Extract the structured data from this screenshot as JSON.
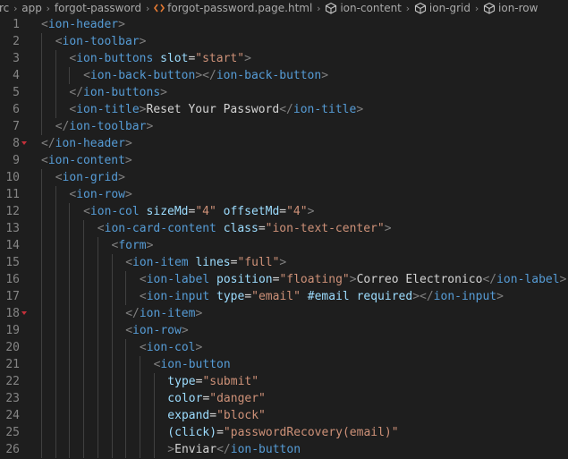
{
  "breadcrumb": {
    "segments": [
      {
        "label": "rc",
        "icon": ""
      },
      {
        "label": "app",
        "icon": ""
      },
      {
        "label": "forgot-password",
        "icon": ""
      },
      {
        "label": "forgot-password.page.html",
        "icon": "html-file-icon"
      },
      {
        "label": "ion-content",
        "icon": "element-cube-icon"
      },
      {
        "label": "ion-grid",
        "icon": "element-cube-icon"
      },
      {
        "label": "ion-row",
        "icon": "element-cube-icon"
      }
    ],
    "separator": "›"
  },
  "colors": {
    "background": "#1e1e1e",
    "line_number": "#858585",
    "punctuation": "#808080",
    "tag": "#569cd6",
    "attribute": "#9cdcfe",
    "string": "#ce9178",
    "text": "#d4d4d4",
    "fold_marker": "#c5303a"
  },
  "lines": [
    {
      "n": "1",
      "indent": 0,
      "tokens": [
        [
          "pn",
          "<"
        ],
        [
          "tg",
          "ion-header"
        ],
        [
          "pn",
          ">"
        ]
      ]
    },
    {
      "n": "2",
      "indent": 1,
      "tokens": [
        [
          "pn",
          "<"
        ],
        [
          "tg",
          "ion-toolbar"
        ],
        [
          "pn",
          ">"
        ]
      ]
    },
    {
      "n": "3",
      "indent": 2,
      "tokens": [
        [
          "pn",
          "<"
        ],
        [
          "tg",
          "ion-buttons"
        ],
        [
          "tx",
          " "
        ],
        [
          "at",
          "slot"
        ],
        [
          "tx",
          "="
        ],
        [
          "st",
          "\"start\""
        ],
        [
          "pn",
          ">"
        ]
      ]
    },
    {
      "n": "4",
      "indent": 3,
      "tokens": [
        [
          "pn",
          "<"
        ],
        [
          "tg",
          "ion-back-button"
        ],
        [
          "pn",
          "></"
        ],
        [
          "tg",
          "ion-back-button"
        ],
        [
          "pn",
          ">"
        ]
      ]
    },
    {
      "n": "5",
      "indent": 2,
      "tokens": [
        [
          "pn",
          "</"
        ],
        [
          "tg",
          "ion-buttons"
        ],
        [
          "pn",
          ">"
        ]
      ]
    },
    {
      "n": "6",
      "indent": 2,
      "tokens": [
        [
          "pn",
          "<"
        ],
        [
          "tg",
          "ion-title"
        ],
        [
          "pn",
          ">"
        ],
        [
          "tx",
          "Reset Your Password"
        ],
        [
          "pn",
          "</"
        ],
        [
          "tg",
          "ion-title"
        ],
        [
          "pn",
          ">"
        ]
      ]
    },
    {
      "n": "7",
      "indent": 1,
      "tokens": [
        [
          "pn",
          "</"
        ],
        [
          "tg",
          "ion-toolbar"
        ],
        [
          "pn",
          ">"
        ]
      ]
    },
    {
      "n": "8",
      "indent": 0,
      "fold": true,
      "tokens": [
        [
          "pn",
          "</"
        ],
        [
          "tg",
          "ion-header"
        ],
        [
          "pn",
          ">"
        ]
      ]
    },
    {
      "n": "9",
      "indent": 0,
      "tokens": [
        [
          "pn",
          "<"
        ],
        [
          "tg",
          "ion-content"
        ],
        [
          "pn",
          ">"
        ]
      ]
    },
    {
      "n": "10",
      "indent": 1,
      "tokens": [
        [
          "pn",
          "<"
        ],
        [
          "tg",
          "ion-grid"
        ],
        [
          "pn",
          ">"
        ]
      ]
    },
    {
      "n": "11",
      "indent": 2,
      "tokens": [
        [
          "pn",
          "<"
        ],
        [
          "tg",
          "ion-row"
        ],
        [
          "pn",
          ">"
        ]
      ]
    },
    {
      "n": "12",
      "indent": 3,
      "tokens": [
        [
          "pn",
          "<"
        ],
        [
          "tg",
          "ion-col"
        ],
        [
          "tx",
          " "
        ],
        [
          "at",
          "sizeMd"
        ],
        [
          "tx",
          "="
        ],
        [
          "st",
          "\"4\""
        ],
        [
          "tx",
          " "
        ],
        [
          "at",
          "offsetMd"
        ],
        [
          "tx",
          "="
        ],
        [
          "st",
          "\"4\""
        ],
        [
          "pn",
          ">"
        ]
      ]
    },
    {
      "n": "13",
      "indent": 4,
      "tokens": [
        [
          "pn",
          "<"
        ],
        [
          "tg",
          "ion-card-content"
        ],
        [
          "tx",
          " "
        ],
        [
          "at",
          "class"
        ],
        [
          "tx",
          "="
        ],
        [
          "st",
          "\"ion-text-center\""
        ],
        [
          "pn",
          ">"
        ]
      ]
    },
    {
      "n": "14",
      "indent": 5,
      "tokens": [
        [
          "pn",
          "<"
        ],
        [
          "tg",
          "form"
        ],
        [
          "pn",
          ">"
        ]
      ]
    },
    {
      "n": "15",
      "indent": 6,
      "tokens": [
        [
          "pn",
          "<"
        ],
        [
          "tg",
          "ion-item"
        ],
        [
          "tx",
          " "
        ],
        [
          "at",
          "lines"
        ],
        [
          "tx",
          "="
        ],
        [
          "st",
          "\"full\""
        ],
        [
          "pn",
          ">"
        ]
      ]
    },
    {
      "n": "16",
      "indent": 7,
      "tokens": [
        [
          "pn",
          "<"
        ],
        [
          "tg",
          "ion-label"
        ],
        [
          "tx",
          " "
        ],
        [
          "at",
          "position"
        ],
        [
          "tx",
          "="
        ],
        [
          "st",
          "\"floating\""
        ],
        [
          "pn",
          ">"
        ],
        [
          "tx",
          "Correo Electronico"
        ],
        [
          "pn",
          "</"
        ],
        [
          "tg",
          "ion-label"
        ],
        [
          "pn",
          ">"
        ]
      ]
    },
    {
      "n": "17",
      "indent": 7,
      "tokens": [
        [
          "pn",
          "<"
        ],
        [
          "tg",
          "ion-input"
        ],
        [
          "tx",
          " "
        ],
        [
          "at",
          "type"
        ],
        [
          "tx",
          "="
        ],
        [
          "st",
          "\"email\""
        ],
        [
          "tx",
          " "
        ],
        [
          "at",
          "#email"
        ],
        [
          "tx",
          " "
        ],
        [
          "at",
          "required"
        ],
        [
          "pn",
          "></"
        ],
        [
          "tg",
          "ion-input"
        ],
        [
          "pn",
          ">"
        ]
      ]
    },
    {
      "n": "18",
      "indent": 6,
      "fold": true,
      "tokens": [
        [
          "pn",
          "</"
        ],
        [
          "tg",
          "ion-item"
        ],
        [
          "pn",
          ">"
        ]
      ]
    },
    {
      "n": "19",
      "indent": 6,
      "tokens": [
        [
          "pn",
          "<"
        ],
        [
          "tg",
          "ion-row"
        ],
        [
          "pn",
          ">"
        ]
      ]
    },
    {
      "n": "20",
      "indent": 7,
      "tokens": [
        [
          "pn",
          "<"
        ],
        [
          "tg",
          "ion-col"
        ],
        [
          "pn",
          ">"
        ]
      ]
    },
    {
      "n": "21",
      "indent": 8,
      "tokens": [
        [
          "pn",
          "<"
        ],
        [
          "tg",
          "ion-button"
        ]
      ]
    },
    {
      "n": "22",
      "indent": 9,
      "tokens": [
        [
          "at",
          "type"
        ],
        [
          "tx",
          "="
        ],
        [
          "st",
          "\"submit\""
        ]
      ]
    },
    {
      "n": "23",
      "indent": 9,
      "tokens": [
        [
          "at",
          "color"
        ],
        [
          "tx",
          "="
        ],
        [
          "st",
          "\"danger\""
        ]
      ]
    },
    {
      "n": "24",
      "indent": 9,
      "tokens": [
        [
          "at",
          "expand"
        ],
        [
          "tx",
          "="
        ],
        [
          "st",
          "\"block\""
        ]
      ]
    },
    {
      "n": "25",
      "indent": 9,
      "tokens": [
        [
          "at",
          "(click)"
        ],
        [
          "tx",
          "="
        ],
        [
          "st",
          "\"passwordRecovery(email)\""
        ]
      ]
    },
    {
      "n": "26",
      "indent": 9,
      "tokens": [
        [
          "pn",
          ">"
        ],
        [
          "tx",
          "Enviar"
        ],
        [
          "pn",
          "</"
        ],
        [
          "tg",
          "ion-button"
        ]
      ]
    }
  ]
}
